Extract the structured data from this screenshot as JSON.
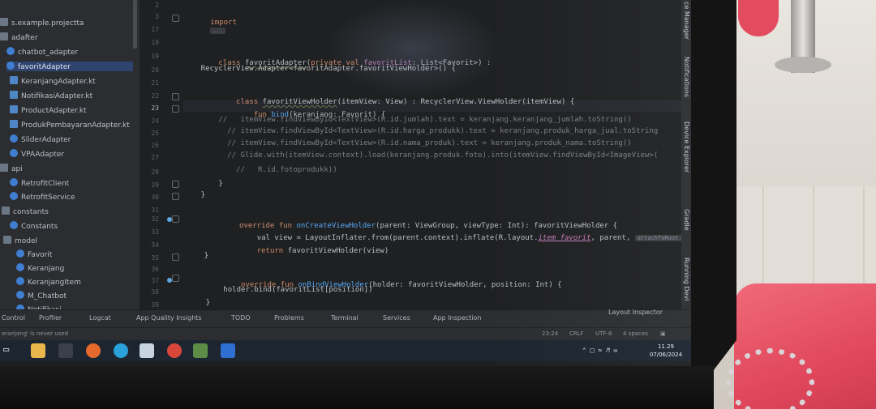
{
  "tree": {
    "items": [
      {
        "label": "s.example.projectta",
        "icon": "folder-icon"
      },
      {
        "label": "adafter",
        "icon": "folder-icon"
      },
      {
        "label": "chatbot_adapter",
        "icon": "kotlin-class-icon"
      },
      {
        "label": "favoritAdapter",
        "icon": "kotlin-class-icon",
        "selected": true
      },
      {
        "label": "KeranjangAdapter.kt",
        "icon": "kotlin-file-icon"
      },
      {
        "label": "NotifikasiAdapter.kt",
        "icon": "kotlin-file-icon"
      },
      {
        "label": "ProductAdapter.kt",
        "icon": "kotlin-file-icon"
      },
      {
        "label": "ProdukPembayaranAdapter.kt",
        "icon": "kotlin-file-icon"
      },
      {
        "label": "SliderAdapter",
        "icon": "kotlin-class-icon"
      },
      {
        "label": "VPAAdapter",
        "icon": "kotlin-class-icon"
      },
      {
        "label": "api",
        "icon": "folder-icon"
      },
      {
        "label": "RetrofitClient",
        "icon": "kotlin-class-icon"
      },
      {
        "label": "RetrofitService",
        "icon": "kotlin-class-icon"
      },
      {
        "label": "constants",
        "icon": "folder-icon"
      },
      {
        "label": "Constants",
        "icon": "kotlin-class-icon"
      },
      {
        "label": "model",
        "icon": "folder-icon"
      },
      {
        "label": "Favorit",
        "icon": "kotlin-class-icon"
      },
      {
        "label": "Keranjang",
        "icon": "kotlin-class-icon"
      },
      {
        "label": "KeranjangItem",
        "icon": "kotlin-class-icon"
      },
      {
        "label": "M_Chatbot",
        "icon": "kotlin-class-icon"
      },
      {
        "label": "Notifikasi",
        "icon": "kotlin-class-icon"
      }
    ]
  },
  "gutter": {
    "lines": [
      "2",
      "3",
      "17",
      "18",
      "19",
      "20",
      "21",
      "22",
      "23",
      "24",
      "25",
      "26",
      "27",
      "28",
      "29",
      "30",
      "31",
      "32",
      "33",
      "34",
      "35",
      "36",
      "37",
      "38",
      "39"
    ],
    "current_line": "23"
  },
  "code": {
    "l_import_kw": "import",
    "l_import_fold": "...",
    "l19": [
      "class ",
      "favoritAdapter",
      "(",
      "private val ",
      "favoritList",
      ": List<Favorit>) :"
    ],
    "l20": "    RecyclerView.Adapter<favoritAdapter.favoritViewHolder>() {",
    "l22": [
      "    class ",
      "favoritViewHolder",
      "(itemView: View) : RecyclerView.ViewHolder(itemView) {"
    ],
    "l23": [
      "        fun ",
      "bind",
      "(keranjang: Favorit) {"
    ],
    "l24": "        //   itemView.findViewById<TextView>(R.id.jumlah).text = keranjang.keranjang_jumlah.toString()",
    "l25": "          // itemView.findViewById<TextView>(R.id.harga_produkk).text = keranjang.produk_harga_jual.toString",
    "l26": "          // itemView.findViewById<TextView>(R.id.nama_produk).text = keranjang.produk_nama.toString()",
    "l27": "          // Glide.with(itemView.context).load(keranjang.produk.foto).into(itemView.findViewById<ImageView>(",
    "l28": "            //   R.id.fotoprodukk))",
    "l29": "        }",
    "l30": "    }",
    "l32": [
      "    override fun ",
      "onCreateViewHolder",
      "(parent: ViewGroup, viewType: Int): favoritViewHolder {"
    ],
    "l33a": "        val view = LayoutInflater.from(parent.context).inflate(R.layout.",
    "l33b": "item_favorit",
    "l33c": ", parent, ",
    "l33hint": "attachToRoot:",
    "l33d": " false",
    "l34": [
      "        return ",
      "favoritViewHolder(view)"
    ],
    "l35": "    }",
    "l37": [
      "    override fun ",
      "onBindViewHolder",
      "(holder: favoritViewHolder, position: Int) {"
    ],
    "l38": "        holder.bind(favoritList[position])",
    "l39": "    }"
  },
  "right_strip": {
    "labels": [
      "ce Manager",
      "Notifications",
      "Device Explorer",
      "Gradle",
      "Running Devi"
    ]
  },
  "toolbar": {
    "items": [
      "Control",
      "Profiler",
      "Logcat",
      "App Quality Insights",
      "TODO",
      "Problems",
      "Terminal",
      "Services",
      "App Inspection"
    ],
    "layout_inspector": "Layout Inspector"
  },
  "statusbar": {
    "message": "eranjang' is never used",
    "position": "23:24",
    "line_sep": "CRLF",
    "encoding": "UTF-8",
    "indent": "4 spaces"
  },
  "taskbar": {
    "time": "11.29",
    "date": "07/06/2024"
  },
  "colors": {
    "keyword": "#cf8e6d",
    "function": "#56a8f5",
    "comment": "#7a7e85",
    "selection": "#2e436e"
  }
}
